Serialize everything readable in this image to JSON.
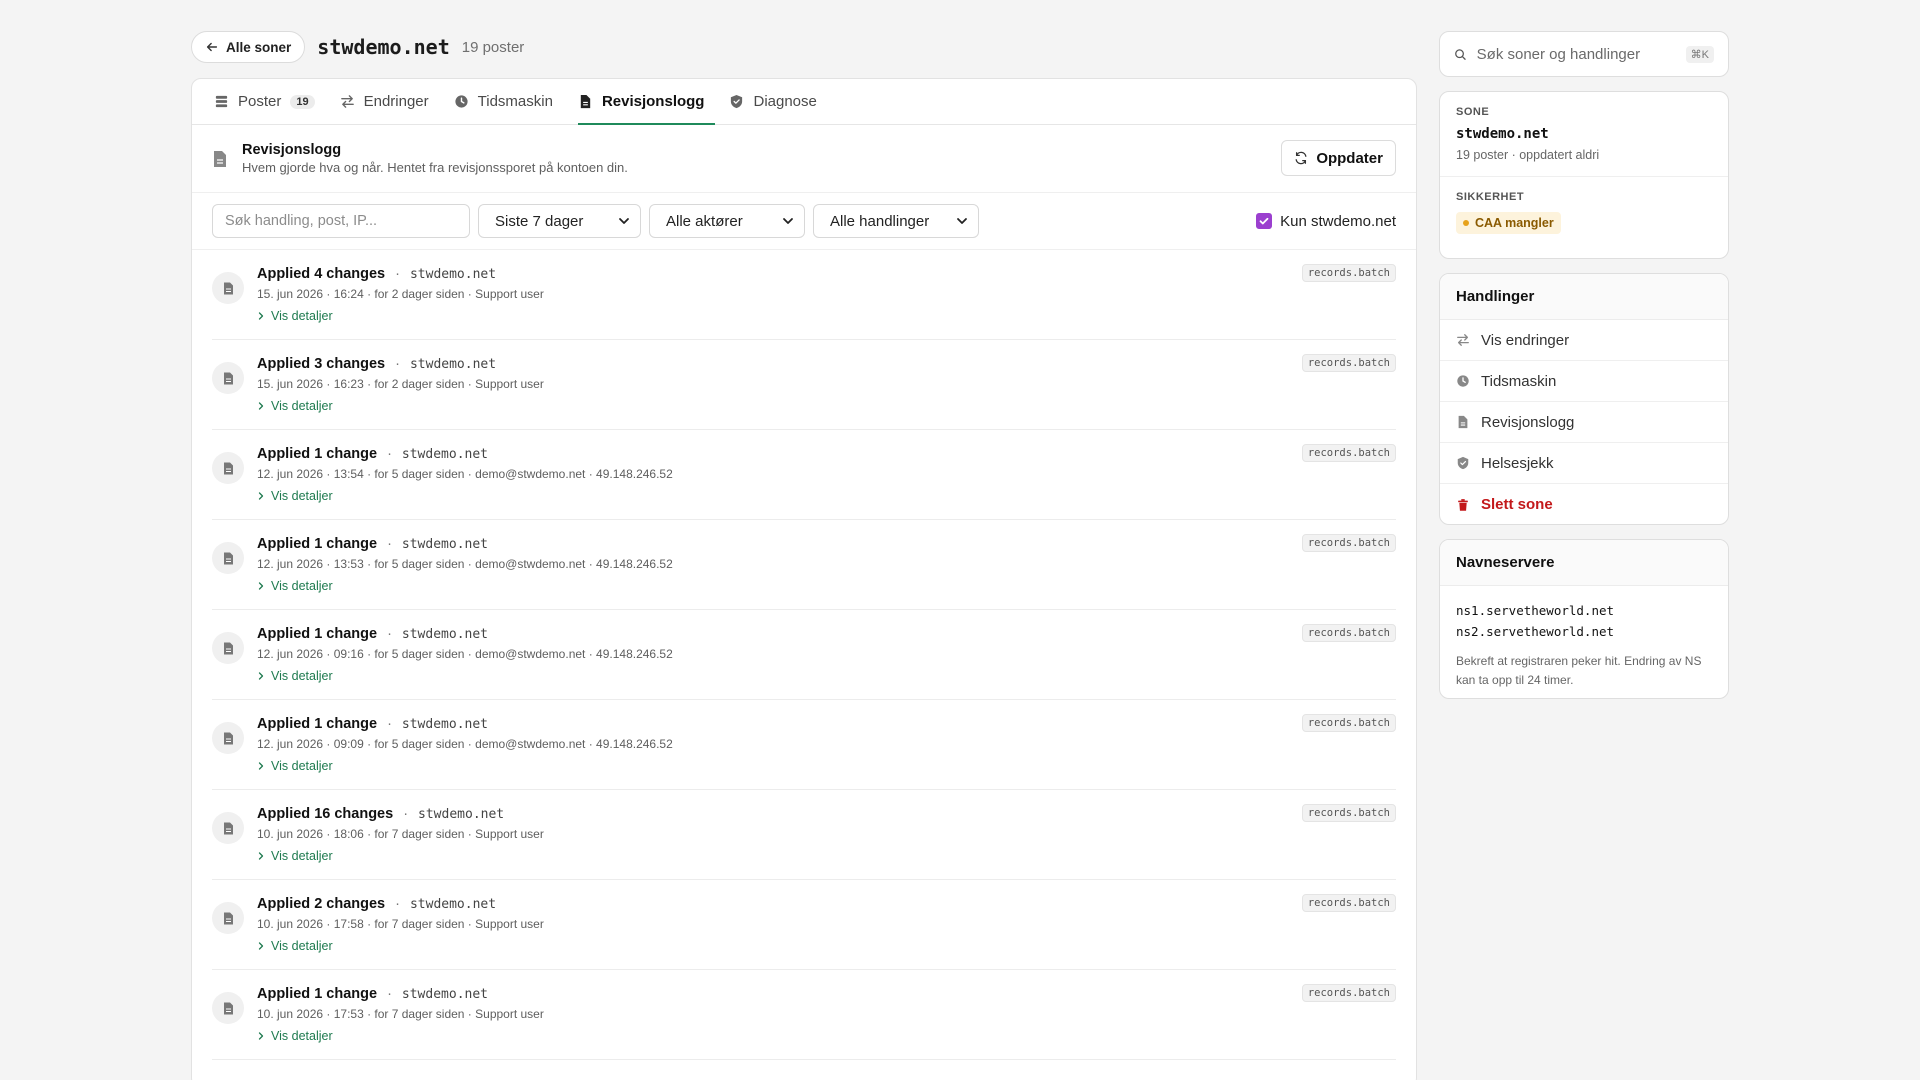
{
  "header": {
    "back_label": "Alle soner",
    "zone_title": "stwdemo.net",
    "zone_count": "19 poster"
  },
  "tabs": [
    {
      "label": "Poster",
      "badge": "19",
      "icon": "list-icon"
    },
    {
      "label": "Endringer",
      "icon": "swap-icon"
    },
    {
      "label": "Tidsmaskin",
      "icon": "clock-icon"
    },
    {
      "label": "Revisjonslogg",
      "icon": "document-icon",
      "active": true
    },
    {
      "label": "Diagnose",
      "icon": "shield-icon"
    }
  ],
  "section": {
    "title": "Revisjonslogg",
    "subtitle": "Hvem gjorde hva og når. Hentet fra revisjonssporet på kontoen din.",
    "refresh_label": "Oppdater"
  },
  "filters": {
    "search_placeholder": "Søk handling, post, IP...",
    "period": "Siste 7 dager",
    "actors": "Alle aktører",
    "actions": "Alle handlinger",
    "only_zone_label": "Kun stwdemo.net",
    "only_zone_checked": true
  },
  "entries": [
    {
      "title": "Applied 4 changes",
      "domain": "stwdemo.net",
      "meta": "15. jun 2026 · 16:24 · for 2 dager siden · Support user",
      "details": "Vis detaljer",
      "tag": "records.batch"
    },
    {
      "title": "Applied 3 changes",
      "domain": "stwdemo.net",
      "meta": "15. jun 2026 · 16:23 · for 2 dager siden · Support user",
      "details": "Vis detaljer",
      "tag": "records.batch"
    },
    {
      "title": "Applied 1 change",
      "domain": "stwdemo.net",
      "meta": "12. jun 2026 · 13:54 · for 5 dager siden · demo@stwdemo.net · 49.148.246.52",
      "details": "Vis detaljer",
      "tag": "records.batch"
    },
    {
      "title": "Applied 1 change",
      "domain": "stwdemo.net",
      "meta": "12. jun 2026 · 13:53 · for 5 dager siden · demo@stwdemo.net · 49.148.246.52",
      "details": "Vis detaljer",
      "tag": "records.batch"
    },
    {
      "title": "Applied 1 change",
      "domain": "stwdemo.net",
      "meta": "12. jun 2026 · 09:16 · for 5 dager siden · demo@stwdemo.net · 49.148.246.52",
      "details": "Vis detaljer",
      "tag": "records.batch"
    },
    {
      "title": "Applied 1 change",
      "domain": "stwdemo.net",
      "meta": "12. jun 2026 · 09:09 · for 5 dager siden · demo@stwdemo.net · 49.148.246.52",
      "details": "Vis detaljer",
      "tag": "records.batch"
    },
    {
      "title": "Applied 16 changes",
      "domain": "stwdemo.net",
      "meta": "10. jun 2026 · 18:06 · for 7 dager siden · Support user",
      "details": "Vis detaljer",
      "tag": "records.batch"
    },
    {
      "title": "Applied 2 changes",
      "domain": "stwdemo.net",
      "meta": "10. jun 2026 · 17:58 · for 7 dager siden · Support user",
      "details": "Vis detaljer",
      "tag": "records.batch"
    },
    {
      "title": "Applied 1 change",
      "domain": "stwdemo.net",
      "meta": "10. jun 2026 · 17:53 · for 7 dager siden · Support user",
      "details": "Vis detaljer",
      "tag": "records.batch"
    }
  ],
  "sidebar": {
    "search_placeholder": "Søk soner og handlinger",
    "search_kbd": "⌘K",
    "zone": {
      "label": "SONE",
      "name": "stwdemo.net",
      "info": "19 poster · oppdatert aldri"
    },
    "security": {
      "label": "SIKKERHET",
      "badge": "CAA mangler",
      "badge_color": "#e7a21a"
    },
    "actions": {
      "title": "Handlinger",
      "items": [
        {
          "label": "Vis endringer",
          "icon": "swap-icon"
        },
        {
          "label": "Tidsmaskin",
          "icon": "clock-icon"
        },
        {
          "label": "Revisjonslogg",
          "icon": "document-icon"
        },
        {
          "label": "Helsesjekk",
          "icon": "shield-icon"
        },
        {
          "label": "Slett sone",
          "icon": "trash-icon",
          "danger": true
        }
      ]
    },
    "nameservers": {
      "title": "Navneservere",
      "servers": [
        "ns1.servetheworld.net",
        "ns2.servetheworld.net"
      ],
      "note": "Bekreft at registraren peker hit. Endring av NS kan ta opp til 24 timer."
    }
  },
  "colors": {
    "accent": "#1f8a5b",
    "checkbox": "#9b3fcf",
    "danger": "#c3191b"
  }
}
